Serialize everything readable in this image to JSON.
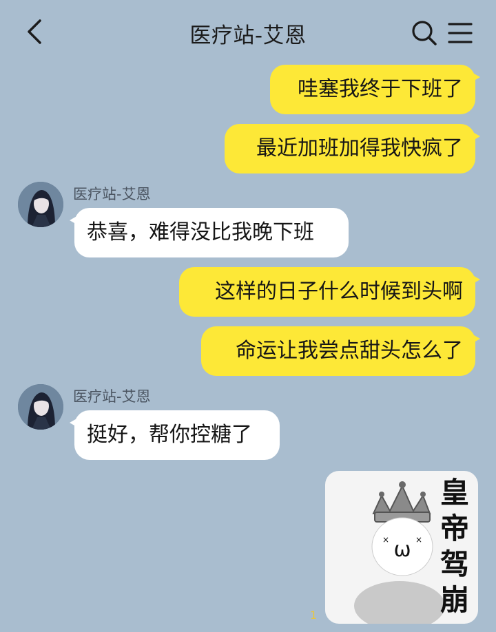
{
  "header": {
    "title": "医疗站-艾恩",
    "icons": [
      "back-arrow-icon",
      "search-icon",
      "menu-icon"
    ]
  },
  "contact": {
    "name": "医疗站-艾恩"
  },
  "messages": [
    {
      "from": "me",
      "text": "哇塞我终于下班了"
    },
    {
      "from": "me",
      "text": "最近加班加得我快疯了"
    },
    {
      "from": "them",
      "sender": "医疗站-艾恩",
      "text": "恭喜，难得没比我晚下班"
    },
    {
      "from": "me",
      "text": "这样的日子什么时候到头啊"
    },
    {
      "from": "me",
      "text": "命运让我尝点甜头怎么了"
    },
    {
      "from": "them",
      "sender": "医疗站-艾恩",
      "text": "挺好，帮你控糖了"
    },
    {
      "from": "me",
      "type": "sticker",
      "text": "皇帝驾崩",
      "face": "ˣωˣ"
    }
  ],
  "unread_indicator": "1",
  "colors": {
    "background": "#a9bdcf",
    "my_bubble": "#fde837",
    "their_bubble": "#ffffff"
  }
}
